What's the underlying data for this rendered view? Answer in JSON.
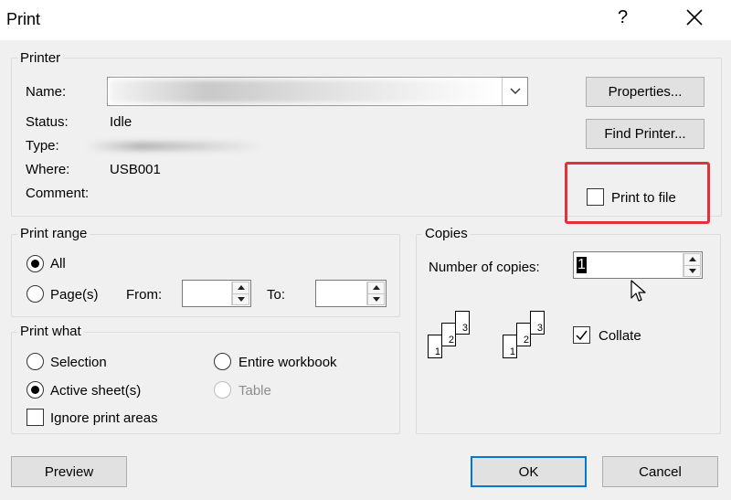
{
  "window": {
    "title": "Print",
    "help": "?"
  },
  "printer": {
    "group_label": "Printer",
    "name_label": "Name:",
    "name_value": "",
    "status_label": "Status:",
    "status_value": "Idle",
    "type_label": "Type:",
    "where_label": "Where:",
    "where_value": "USB001",
    "comment_label": "Comment:",
    "properties_button": "Properties...",
    "find_printer_button": "Find Printer...",
    "print_to_file_label": "Print to file",
    "print_to_file_checked": false
  },
  "print_range": {
    "group_label": "Print range",
    "all_label": "All",
    "pages_label": "Page(s)",
    "from_label": "From:",
    "to_label": "To:",
    "from_value": "",
    "to_value": "",
    "selected": "all"
  },
  "print_what": {
    "group_label": "Print what",
    "selection_label": "Selection",
    "entire_workbook_label": "Entire workbook",
    "active_sheets_label": "Active sheet(s)",
    "table_label": "Table",
    "ignore_print_areas_label": "Ignore print areas",
    "selected": "active_sheets",
    "table_disabled": true,
    "ignore_print_areas_checked": false
  },
  "copies": {
    "group_label": "Copies",
    "number_label": "Number of copies:",
    "number_value": "1",
    "collate_label": "Collate",
    "collate_checked": true,
    "stack_pages": [
      "1",
      "2",
      "3"
    ]
  },
  "footer": {
    "preview_button": "Preview",
    "ok_button": "OK",
    "cancel_button": "Cancel"
  },
  "colors": {
    "highlight_box": "#e0323a",
    "default_button_border": "#0078d7"
  }
}
